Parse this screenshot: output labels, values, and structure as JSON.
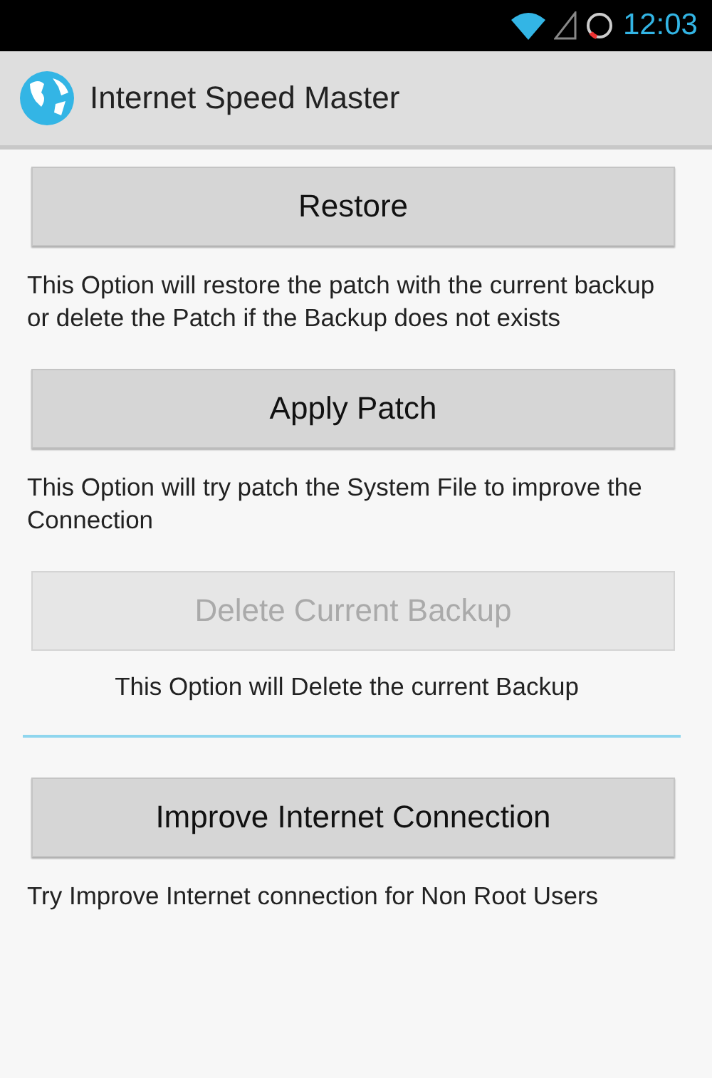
{
  "status_bar": {
    "time": "12:03"
  },
  "action_bar": {
    "title": "Internet Speed Master"
  },
  "items": [
    {
      "kind": "option",
      "label": "Restore",
      "disabled": false,
      "description": "This Option will restore the patch with the current backup or delete the Patch if the Backup does not exists",
      "centered": false
    },
    {
      "kind": "option",
      "label": "Apply Patch",
      "disabled": false,
      "description": "This Option will try patch the System File to improve the Connection",
      "centered": false
    },
    {
      "kind": "option",
      "label": "Delete Current Backup",
      "disabled": true,
      "description": "This Option will Delete the current Backup",
      "centered": true
    },
    {
      "kind": "divider"
    },
    {
      "kind": "option",
      "label": "Improve Internet Connection",
      "disabled": false,
      "description": "Try Improve Internet connection for Non Root Users",
      "centered": false
    }
  ]
}
